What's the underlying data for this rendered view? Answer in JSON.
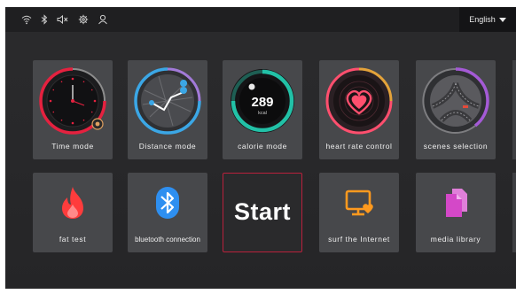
{
  "header": {
    "status_icons": [
      "wifi-icon",
      "bluetooth-icon",
      "speaker-muted-icon",
      "settings-gear-icon",
      "user-icon"
    ],
    "language_label": "English"
  },
  "tiles": {
    "time_mode": {
      "label": "Time mode",
      "icon": "clock-dial-icon",
      "accent": "#e5213f"
    },
    "distance_mode": {
      "label": "Distance mode",
      "icon": "route-map-icon",
      "accent": "#3ba7e6"
    },
    "calorie_mode": {
      "label": "calorie mode",
      "icon": "calorie-ring-icon",
      "value": "289",
      "unit": "kcal",
      "accent": "#22c1a7"
    },
    "heart_rate_control": {
      "label": "heart rate control",
      "icon": "heart-icon",
      "accent": "#ff4f6e"
    },
    "scenes_selection": {
      "label": "scenes selection",
      "icon": "road-scene-icon",
      "accent": "#a45ad6"
    },
    "fat_test": {
      "label": "fat test",
      "icon": "flame-icon",
      "accent": "#ff3c3c"
    },
    "bluetooth_connection": {
      "label": "bluetooth connection",
      "icon": "bluetooth-icon",
      "accent": "#2e8ff0"
    },
    "start": {
      "label": "Start",
      "accent": "#b9203c"
    },
    "surf_internet": {
      "label": "surf the Internet",
      "icon": "tv-heart-icon",
      "accent": "#ff9a1e"
    },
    "media_library": {
      "label": "media library",
      "icon": "documents-icon",
      "accent": "#d448c8"
    }
  }
}
